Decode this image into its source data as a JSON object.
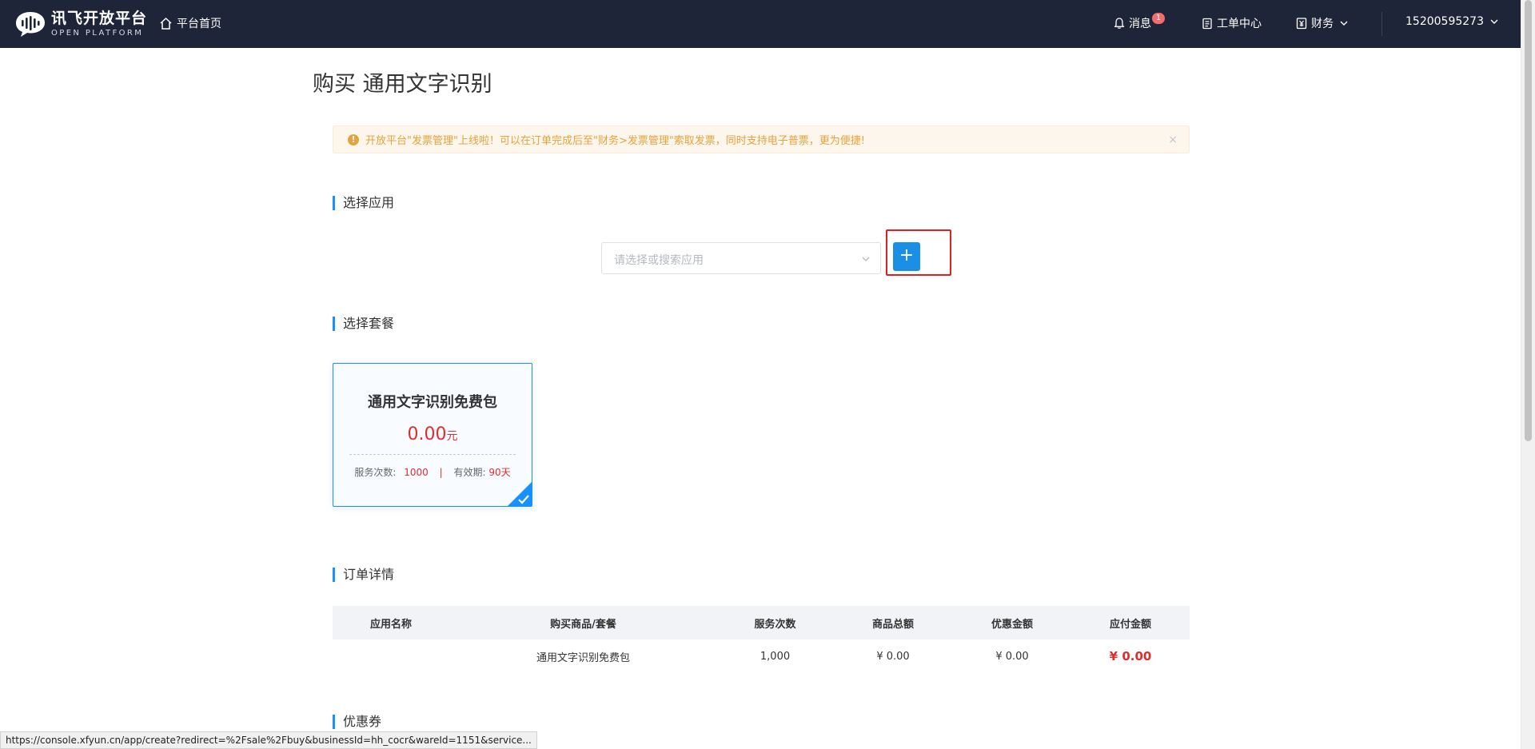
{
  "header": {
    "logo_cn": "讯飞开放平台",
    "logo_en": "OPEN PLATFORM",
    "home_label": "平台首页",
    "messages_label": "消息",
    "messages_badge": "1",
    "tickets_label": "工单中心",
    "finance_label": "财务",
    "account_label": "15200595273"
  },
  "page": {
    "title": "购买 通用文字识别"
  },
  "alert": {
    "text": "开放平台\"发票管理\"上线啦！可以在订单完成后至\"财务>发票管理\"索取发票，同时支持电子普票，更为便捷!",
    "close_symbol": "×"
  },
  "select_app": {
    "section_title": "选择应用",
    "placeholder": "请选择或搜索应用",
    "add_symbol": "+"
  },
  "select_package": {
    "section_title": "选择套餐",
    "card": {
      "name": "通用文字识别免费包",
      "price": "0.00",
      "unit": "元",
      "count_label": "服务次数:",
      "count_value": "1000",
      "separator": "|",
      "validity_label": "有效期:",
      "validity_value": "90天",
      "selected": true
    }
  },
  "order_details": {
    "section_title": "订单详情",
    "columns": [
      "应用名称",
      "购买商品/套餐",
      "服务次数",
      "商品总额",
      "优惠金额",
      "应付金额"
    ],
    "row": [
      "",
      "通用文字识别免费包",
      "1,000",
      "¥ 0.00",
      "¥ 0.00",
      "¥ 0.00"
    ]
  },
  "coupon": {
    "section_title": "优惠券"
  },
  "status_bar": {
    "url": "https://console.xfyun.cn/app/create?redirect=%2Fsale%2Fbuy&businessId=hh_cocr&wareId=1151&service..."
  },
  "colors": {
    "nav_bg": "#1f2538",
    "accent": "#1890ff",
    "price_red": "#e02c2c",
    "warning": "#e6a23c"
  }
}
